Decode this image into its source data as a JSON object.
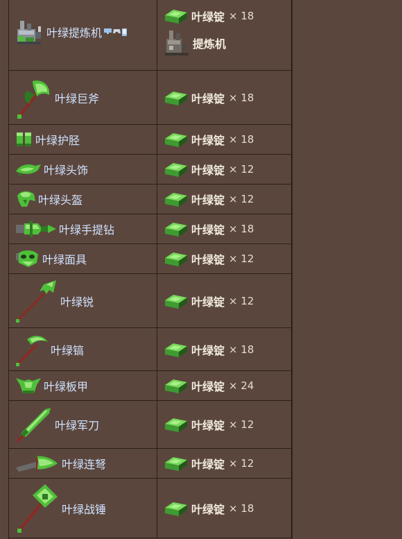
{
  "ingredient_name": "叶绿锭",
  "colors": {
    "page_bg": "#5b463d",
    "border": "#2a1f1a",
    "item_text": "#cfe3ff",
    "ingot_green": "#49a83a"
  },
  "station": {
    "label": "提炼机"
  },
  "rows": [
    {
      "name": "叶绿提炼机",
      "qty": "× 18",
      "icon": "extractinator-icon",
      "has_station": true,
      "has_platform_icons": true
    },
    {
      "name": "叶绿巨斧",
      "qty": "× 18",
      "icon": "greataxe-icon"
    },
    {
      "name": "叶绿护胫",
      "qty": "× 18",
      "icon": "greaves-icon"
    },
    {
      "name": "叶绿头饰",
      "qty": "× 12",
      "icon": "headgear-icon"
    },
    {
      "name": "叶绿头盔",
      "qty": "× 12",
      "icon": "helmet-icon"
    },
    {
      "name": "叶绿手提钻",
      "qty": "× 18",
      "icon": "jackhammer-icon"
    },
    {
      "name": "叶绿面具",
      "qty": "× 12",
      "icon": "mask-icon"
    },
    {
      "name": "叶绿锐",
      "qty": "× 12",
      "icon": "partisan-icon"
    },
    {
      "name": "叶绿镐",
      "qty": "× 18",
      "icon": "pickaxe-icon"
    },
    {
      "name": "叶绿板甲",
      "qty": "× 24",
      "icon": "plate-mail-icon"
    },
    {
      "name": "叶绿军刀",
      "qty": "× 12",
      "icon": "saber-icon"
    },
    {
      "name": "叶绿连弩",
      "qty": "× 12",
      "icon": "repeater-icon"
    },
    {
      "name": "叶绿战锤",
      "qty": "× 18",
      "icon": "warhammer-icon"
    }
  ]
}
